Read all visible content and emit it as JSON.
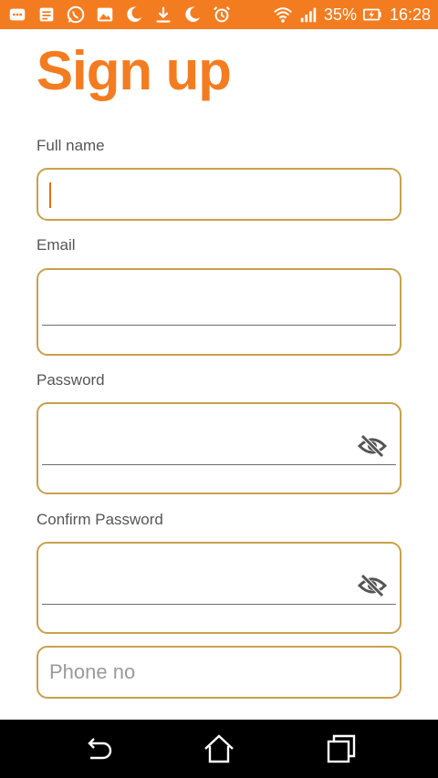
{
  "status_bar": {
    "battery": "35%",
    "time": "16:28",
    "left_icons": [
      "message-icon",
      "notes-icon",
      "whatsapp-icon",
      "image-icon",
      "moon-icon",
      "download-icon",
      "moon-icon",
      "alarm-icon"
    ],
    "right_icons": [
      "wifi-icon",
      "signal-icon",
      "battery-icon"
    ]
  },
  "page": {
    "title": "Sign up"
  },
  "form": {
    "full_name": {
      "label": "Full name",
      "value": ""
    },
    "email": {
      "label": "Email",
      "value": ""
    },
    "password": {
      "label": "Password",
      "value": ""
    },
    "confirm_password": {
      "label": "Confirm Password",
      "value": ""
    },
    "phone": {
      "placeholder": "Phone no",
      "value": ""
    }
  },
  "colors": {
    "accent": "#f47c20",
    "field_border": "#c9a04a",
    "label": "#555555"
  },
  "nav_bar": {
    "buttons": [
      "back-icon",
      "home-icon",
      "recents-icon"
    ]
  }
}
